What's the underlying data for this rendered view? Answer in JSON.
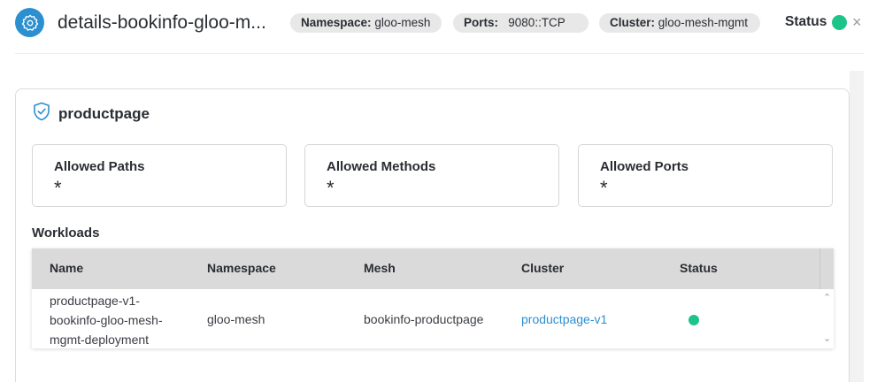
{
  "header": {
    "title": "details-bookinfo-gloo-m...",
    "namespace": {
      "label": "Namespace:",
      "value": "gloo-mesh"
    },
    "ports": {
      "label": "Ports:",
      "value": "9080::TCP"
    },
    "cluster": {
      "label": "Cluster:",
      "value": "gloo-mesh-mgmt"
    },
    "status_label": "Status",
    "status_color": "#1dc48a",
    "close_icon": "×"
  },
  "policy": {
    "title": "productpage",
    "boxes": [
      {
        "label": "Allowed Paths",
        "value": "*"
      },
      {
        "label": "Allowed Methods",
        "value": "*"
      },
      {
        "label": "Allowed Ports",
        "value": "*"
      }
    ]
  },
  "workloads": {
    "title": "Workloads",
    "columns": [
      "Name",
      "Namespace",
      "Mesh",
      "Cluster",
      "Status"
    ],
    "rows": [
      {
        "name": "productpage-v1-bookinfo-gloo-mesh-mgmt-deployment",
        "namespace": "gloo-mesh",
        "mesh": "bookinfo-productpage",
        "cluster": "productpage-v1",
        "status_color": "#1dc48a"
      }
    ]
  },
  "colors": {
    "accent": "#2b8fd0",
    "ok": "#1dc48a"
  }
}
